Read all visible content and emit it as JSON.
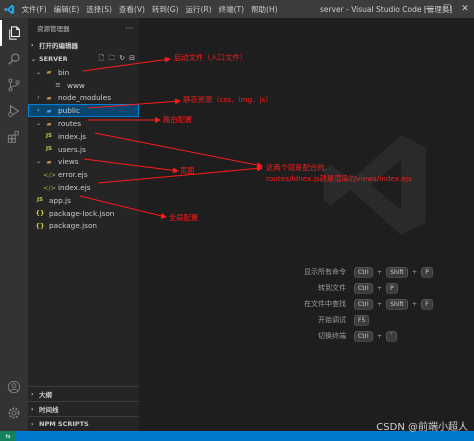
{
  "menu": [
    "文件(F)",
    "编辑(E)",
    "选择(S)",
    "查看(V)",
    "转到(G)",
    "运行(R)",
    "终端(T)",
    "帮助(H)"
  ],
  "window_title": "server - Visual Studio Code [管理员]",
  "sidebar": {
    "header": "资源管理器",
    "open_editors": "打开的编辑器",
    "folder": "SERVER",
    "tree": [
      {
        "label": "bin",
        "type": "folder",
        "icon": "folder-bin-icon",
        "depth": 1,
        "expanded": true
      },
      {
        "label": "www",
        "type": "file",
        "icon": "file-icon",
        "depth": 2
      },
      {
        "label": "node_modules",
        "type": "folder",
        "icon": "folder-icon",
        "depth": 1,
        "expanded": false
      },
      {
        "label": "public",
        "type": "folder",
        "icon": "folder-public-icon",
        "depth": 1,
        "expanded": false,
        "selected": true
      },
      {
        "label": "routes",
        "type": "folder",
        "icon": "folder-routes-icon",
        "depth": 1,
        "expanded": true
      },
      {
        "label": "index.js",
        "type": "file",
        "icon": "js-icon",
        "depth": 2
      },
      {
        "label": "users.js",
        "type": "file",
        "icon": "js-icon",
        "depth": 2
      },
      {
        "label": "views",
        "type": "folder",
        "icon": "folder-views-icon",
        "depth": 1,
        "expanded": true
      },
      {
        "label": "error.ejs",
        "type": "file",
        "icon": "ejs-icon",
        "depth": 2
      },
      {
        "label": "index.ejs",
        "type": "file",
        "icon": "ejs-icon",
        "depth": 2
      },
      {
        "label": "app.js",
        "type": "file",
        "icon": "js-icon",
        "depth": 1
      },
      {
        "label": "package-lock.json",
        "type": "file",
        "icon": "json-icon",
        "depth": 1
      },
      {
        "label": "package.json",
        "type": "file",
        "icon": "json-icon",
        "depth": 1
      }
    ],
    "bottom_sections": [
      "大纲",
      "时间线",
      "NPM SCRIPTS"
    ]
  },
  "shortcuts": [
    {
      "label": "显示所有命令",
      "keys": [
        "Ctrl",
        "Shift",
        "P"
      ]
    },
    {
      "label": "转到文件",
      "keys": [
        "Ctrl",
        "P"
      ]
    },
    {
      "label": "在文件中查找",
      "keys": [
        "Ctrl",
        "Shift",
        "F"
      ]
    },
    {
      "label": "开始调试",
      "keys": [
        "F5"
      ]
    },
    {
      "label": "切换终端",
      "keys": [
        "Ctrl",
        "`"
      ]
    }
  ],
  "annotations": {
    "bin": "启动文件（入口文件）",
    "public": "静态资源（css、img、js）",
    "routes": "路由配置",
    "views": "页面",
    "note_line1": "这两个就是配合的,",
    "note_line2": "routes/ldnex.js就是渲染的views/index.ejs",
    "app": "全局配置"
  },
  "watermark_text": "CSDN @前端小超人",
  "status": {
    "remote": "⇆"
  },
  "colors": {
    "accent": "#007acc",
    "annotation": "#ff1a1a",
    "selection": "#094771"
  }
}
